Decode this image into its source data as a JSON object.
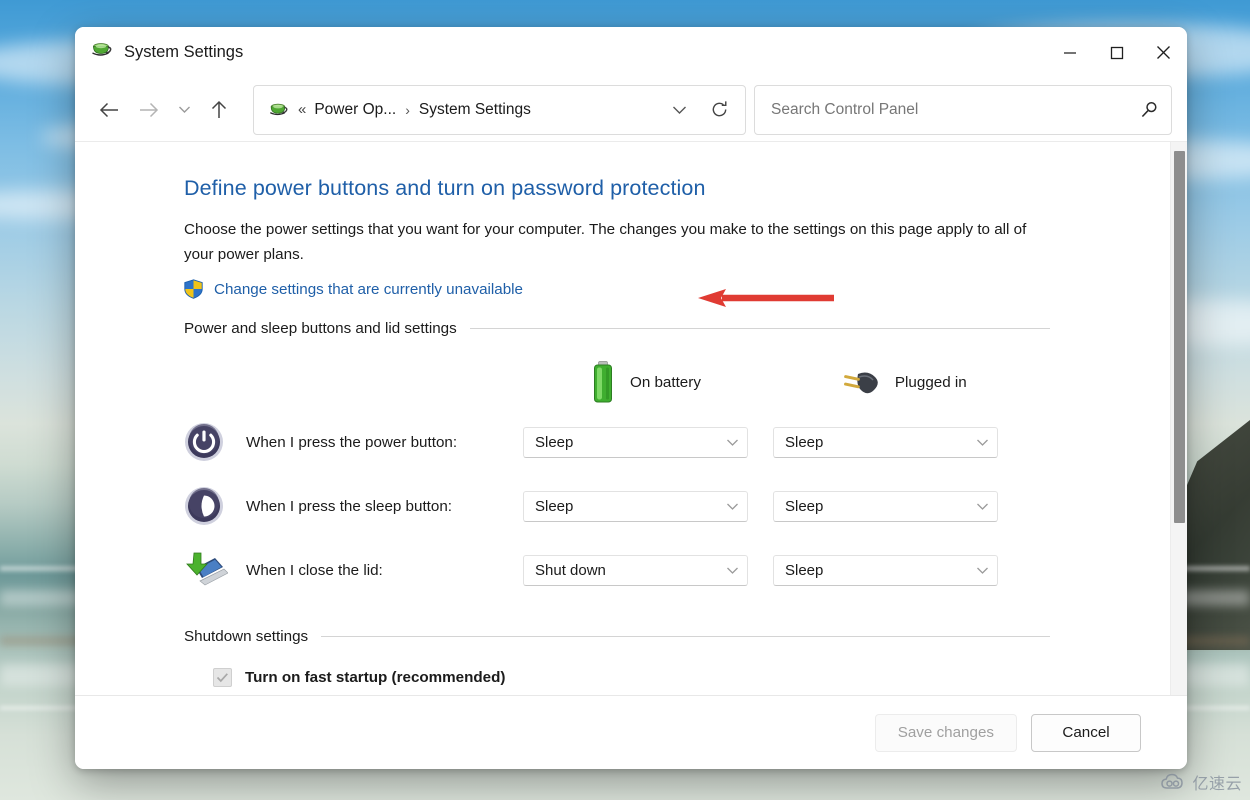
{
  "window": {
    "title": "System Settings",
    "title_icon": "power-options-icon",
    "controls": {
      "minimize": "minimize-icon",
      "maximize": "maximize-icon",
      "close": "close-icon"
    }
  },
  "nav": {
    "back": "back-arrow-icon",
    "forward": "forward-arrow-icon",
    "recent": "chevron-down-icon",
    "up": "up-arrow-icon",
    "address": {
      "icon": "power-options-icon",
      "overflow": "«",
      "crumbs": [
        "Power Op...",
        "System Settings"
      ],
      "separator": "›",
      "dropdown": "chevron-down-icon",
      "refresh": "refresh-icon"
    },
    "search": {
      "placeholder": "Search Control Panel",
      "icon": "search-icon"
    }
  },
  "page": {
    "title": "Define power buttons and turn on password protection",
    "description": "Choose the power settings that you want for your computer. The changes you make to the settings on this page apply to all of your power plans.",
    "uac_link": "Change settings that are currently unavailable",
    "uac_icon": "uac-shield-icon",
    "annotation_arrow": "red-arrow-pointing-left"
  },
  "sections": [
    {
      "heading": "Power and sleep buttons and lid settings",
      "columns": [
        {
          "label": "On battery",
          "icon": "battery-icon"
        },
        {
          "label": "Plugged in",
          "icon": "power-plug-icon"
        }
      ],
      "rows": [
        {
          "icon": "power-button-icon",
          "label": "When I press the power button:",
          "on_battery": "Sleep",
          "plugged_in": "Sleep"
        },
        {
          "icon": "sleep-button-icon",
          "label": "When I press the sleep button:",
          "on_battery": "Sleep",
          "plugged_in": "Sleep"
        },
        {
          "icon": "laptop-lid-icon",
          "label": "When I close the lid:",
          "on_battery": "Shut down",
          "plugged_in": "Sleep"
        }
      ]
    },
    {
      "heading": "Shutdown settings",
      "checkbox": {
        "label": "Turn on fast startup (recommended)",
        "checked": true,
        "disabled": true
      }
    }
  ],
  "footer": {
    "save_label": "Save changes",
    "save_disabled": true,
    "cancel_label": "Cancel"
  },
  "watermark": {
    "text": "亿速云",
    "icon": "cloud-logo-icon"
  },
  "colors": {
    "link": "#1f5fa8",
    "title": "#1f5fa8",
    "annotation": "#e03b33",
    "battery_green": "#46b13a",
    "shield_blue": "#2d73c9",
    "shield_yellow": "#f0c419"
  }
}
